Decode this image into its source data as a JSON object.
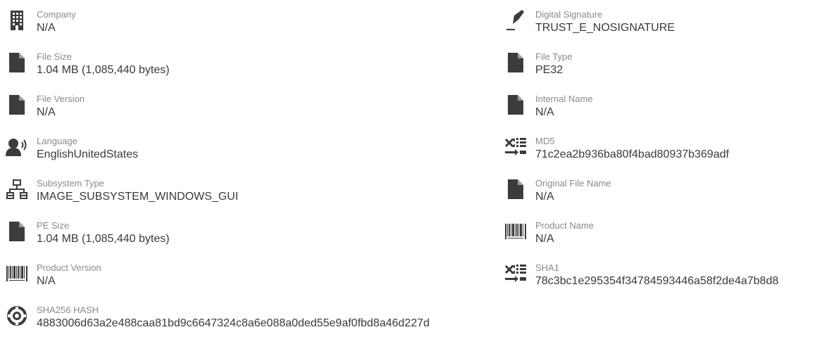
{
  "left_column": [
    {
      "label": "Company",
      "value": "N/A",
      "icon": "building-icon"
    },
    {
      "label": "File Size",
      "value": "1.04 MB (1,085,440 bytes)",
      "icon": "file-icon"
    },
    {
      "label": "File Version",
      "value": "N/A",
      "icon": "file-icon"
    },
    {
      "label": "Language",
      "value": "EnglishUnitedStates",
      "icon": "speaking-person-icon"
    },
    {
      "label": "Subsystem Type",
      "value": "IMAGE_SUBSYSTEM_WINDOWS_GUI",
      "icon": "network-icon"
    },
    {
      "label": "PE Size",
      "value": "1.04 MB (1,085,440 bytes)",
      "icon": "file-icon"
    },
    {
      "label": "Product Version",
      "value": "N/A",
      "icon": "barcode-icon"
    },
    {
      "label": "SHA256 HASH",
      "value": "4883006d63a2e488caa81bd9c6647324c8a6e088a0ded55e9af0fbd8a46d227d",
      "icon": "lifebuoy-icon"
    }
  ],
  "right_column": [
    {
      "label": "Digital Signature",
      "value": "TRUST_E_NOSIGNATURE",
      "icon": "pen-icon"
    },
    {
      "label": "File Type",
      "value": "PE32",
      "icon": "file-icon"
    },
    {
      "label": "Internal Name",
      "value": "N/A",
      "icon": "file-icon"
    },
    {
      "label": "MD5",
      "value": "71c2ea2b936ba80f4bad80937b369adf",
      "icon": "shuffle-list-icon"
    },
    {
      "label": "Original File Name",
      "value": "N/A",
      "icon": "file-icon"
    },
    {
      "label": "Product Name",
      "value": "N/A",
      "icon": "barcode-icon"
    },
    {
      "label": "SHA1",
      "value": "78c3bc1e295354f34784593446a58f2de4a7b8d8",
      "icon": "shuffle-list-icon"
    }
  ],
  "colors": {
    "icon": "#3c3c3c",
    "label": "#8a8a8a",
    "value": "#3a3a3a"
  }
}
